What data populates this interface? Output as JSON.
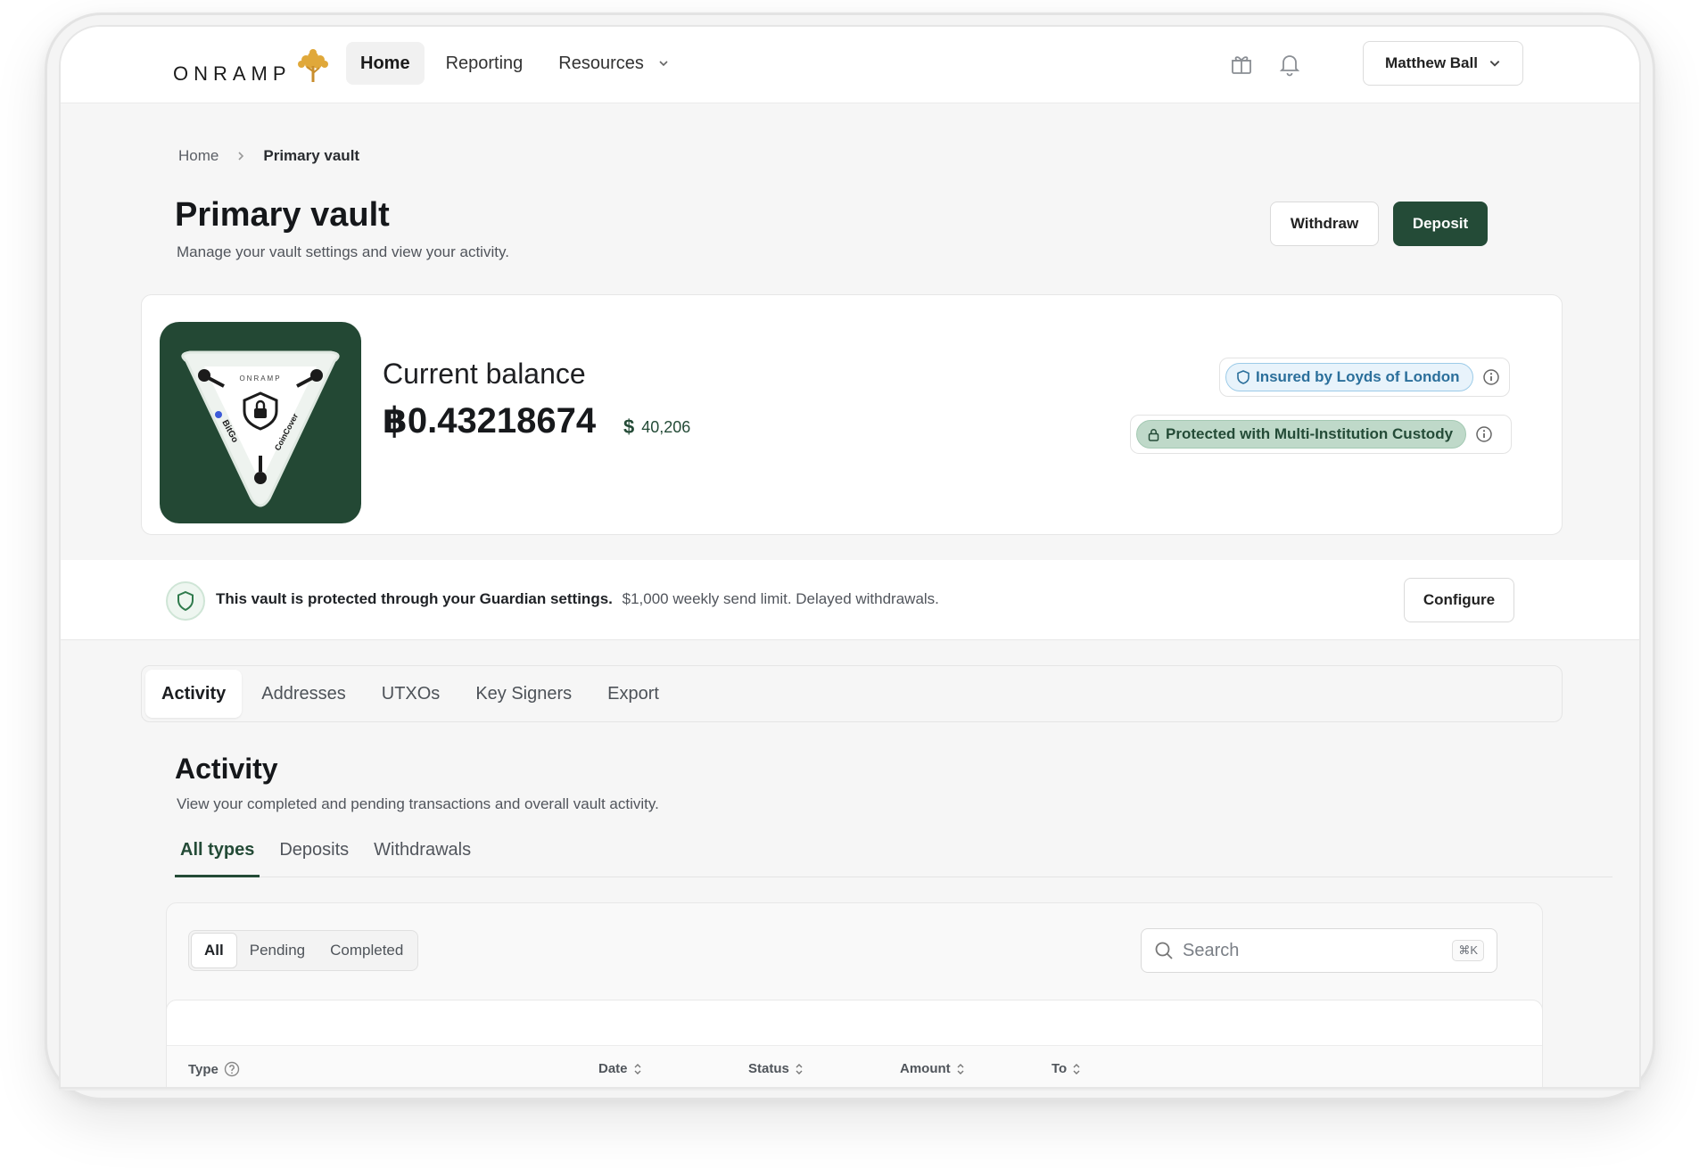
{
  "header": {
    "logo_text": "ONRAMP",
    "nav": [
      {
        "label": "Home"
      },
      {
        "label": "Reporting"
      },
      {
        "label": "Resources"
      }
    ],
    "user_name": "Matthew Ball"
  },
  "breadcrumb": {
    "home": "Home",
    "current": "Primary vault"
  },
  "page": {
    "title": "Primary vault",
    "subtitle": "Manage your vault settings and view your activity.",
    "withdraw_label": "Withdraw",
    "deposit_label": "Deposit"
  },
  "balance": {
    "label": "Current balance",
    "amount": "฿0.43218674",
    "usd_symbol": "$",
    "usd_value": "40,206",
    "insured_badge": "Insured by Loyds of London",
    "custody_badge": "Protected with Multi-Institution Custody"
  },
  "vault_image": {
    "brand": "ONRAMP",
    "left_partner": "BitGo",
    "right_partner": "CoinCover"
  },
  "guardian": {
    "bold_text": "This vault is protected through your Guardian settings.",
    "detail_text": "$1,000 weekly send limit. Delayed withdrawals.",
    "configure_label": "Configure"
  },
  "tabs": [
    {
      "label": "Activity"
    },
    {
      "label": "Addresses"
    },
    {
      "label": "UTXOs"
    },
    {
      "label": "Key Signers"
    },
    {
      "label": "Export"
    }
  ],
  "activity": {
    "title": "Activity",
    "subtitle": "View your completed and pending transactions and overall vault activity.",
    "subtabs": [
      {
        "label": "All types"
      },
      {
        "label": "Deposits"
      },
      {
        "label": "Withdrawals"
      }
    ],
    "filters": [
      {
        "label": "All"
      },
      {
        "label": "Pending"
      },
      {
        "label": "Completed"
      }
    ],
    "search_placeholder": "Search",
    "search_shortcut": "⌘K",
    "columns": [
      {
        "label": "Type"
      },
      {
        "label": "Date"
      },
      {
        "label": "Status"
      },
      {
        "label": "Amount"
      },
      {
        "label": "To"
      }
    ]
  },
  "colors": {
    "brand_green": "#244b37",
    "badge_blue": "#2b6f9b",
    "badge_green_bg": "#bfd9c9"
  }
}
